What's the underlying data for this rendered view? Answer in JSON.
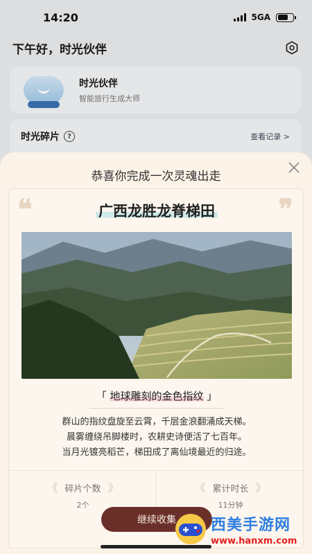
{
  "status": {
    "time": "14:20",
    "network": "5GA"
  },
  "header": {
    "greeting": "下午好，时光伙伴"
  },
  "partner": {
    "name": "时光伙伴",
    "subtitle": "智能旅行生成大师"
  },
  "fragments": {
    "title": "时光碎片",
    "help": "?",
    "view_records": "查看记录 >"
  },
  "modal": {
    "title": "恭喜你完成一次灵魂出走",
    "place": "广西龙胜龙脊梯田",
    "tagline_open": "「",
    "tagline": "地球雕刻的金色指纹",
    "tagline_close": "」",
    "description": [
      "群山的指纹盘旋至云霄，千层金浪翻涌成天梯。",
      "晨雾缠绕吊脚楼时，农耕史诗便活了七百年。",
      "当月光镀亮稻芒，梯田成了离仙境最近的归途。"
    ],
    "stats": [
      {
        "label": "碎片个数",
        "value": "2个"
      },
      {
        "label": "累计时长",
        "value": "11分钟"
      }
    ],
    "continue_label": "继续收集"
  },
  "watermark": {
    "main": "西美手游网",
    "sub": "www.hanxm.com"
  },
  "colors": {
    "modal_bg": "#fbf2e8",
    "button": "#6b2f2a",
    "title_highlight": "#cde9ea",
    "tagline_highlight": "#f6cfd7"
  }
}
